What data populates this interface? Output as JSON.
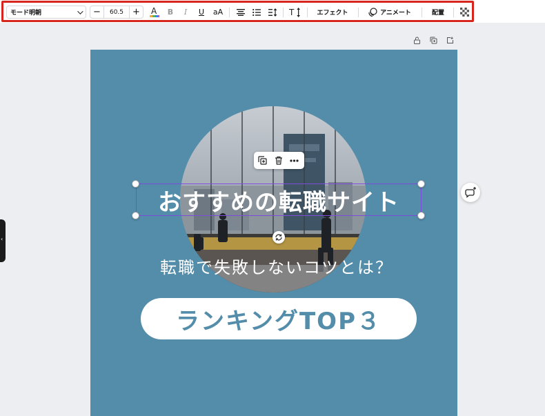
{
  "toolbar": {
    "font_name": "モード明朝",
    "font_size": "60.5",
    "minus": "−",
    "plus": "+",
    "italic": "I",
    "bold": "B",
    "underline": "U",
    "case": "aA",
    "effects_label": "エフェクト",
    "animate_label": "アニメート",
    "position_label": "配置",
    "text_color": "#2c2c2c",
    "highlight_color": "#d7261e"
  },
  "canvas": {
    "background": "#538daa",
    "title": "おすすめの転職サイト",
    "subtitle": "転職で失敗しないコツとは？",
    "button_text": "ランキングTOP３"
  }
}
